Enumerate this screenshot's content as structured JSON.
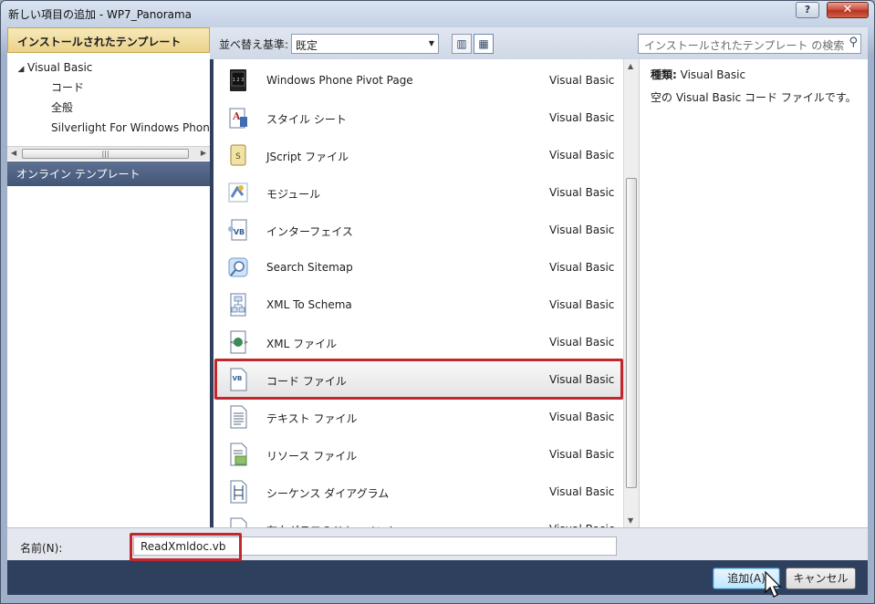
{
  "window": {
    "title": "新しい項目の追加 - WP7_Panorama",
    "help_glyph": "?",
    "close_glyph": "✕"
  },
  "left": {
    "header": "インストールされたテンプレート",
    "tree": [
      {
        "label": "Visual Basic",
        "expanded": true,
        "level": 0
      },
      {
        "label": "コード",
        "level": 1
      },
      {
        "label": "全般",
        "level": 1
      },
      {
        "label": "Silverlight For Windows Phone",
        "level": 1
      }
    ],
    "online": "オンライン テンプレート"
  },
  "toolbar": {
    "sort_label": "並べ替え基準:",
    "sort_value": "既定",
    "search_placeholder": "インストールされたテンプレート の検索"
  },
  "templates": [
    {
      "name": "Windows Phone Pivot Page",
      "lang": "Visual Basic",
      "icon": "pivot-page-icon"
    },
    {
      "name": "スタイル シート",
      "lang": "Visual Basic",
      "icon": "stylesheet-icon"
    },
    {
      "name": "JScript ファイル",
      "lang": "Visual Basic",
      "icon": "jscript-file-icon"
    },
    {
      "name": "モジュール",
      "lang": "Visual Basic",
      "icon": "module-icon"
    },
    {
      "name": "インターフェイス",
      "lang": "Visual Basic",
      "icon": "interface-icon"
    },
    {
      "name": "Search Sitemap",
      "lang": "Visual Basic",
      "icon": "search-sitemap-icon"
    },
    {
      "name": "XML To Schema",
      "lang": "Visual Basic",
      "icon": "xml-schema-icon"
    },
    {
      "name": "XML ファイル",
      "lang": "Visual Basic",
      "icon": "xml-file-icon"
    },
    {
      "name": "コード ファイル",
      "lang": "Visual Basic",
      "icon": "code-file-icon",
      "selected": true
    },
    {
      "name": "テキスト ファイル",
      "lang": "Visual Basic",
      "icon": "text-file-icon"
    },
    {
      "name": "リソース ファイル",
      "lang": "Visual Basic",
      "icon": "resource-file-icon"
    },
    {
      "name": "シーケンス ダイアグラム",
      "lang": "Visual Basic",
      "icon": "sequence-diagram-icon"
    },
    {
      "name": "有向グラフのドキュメント",
      "lang": "Visual Basic",
      "icon": "directed-graph-icon"
    }
  ],
  "details": {
    "kind_label": "種類:",
    "kind_value": "Visual Basic",
    "description": "空の Visual Basic コード ファイルです。"
  },
  "name_field": {
    "label": "名前(N):",
    "value": "ReadXmldoc.vb"
  },
  "buttons": {
    "add": "追加(A)",
    "cancel": "キャンセル"
  },
  "colors": {
    "highlight": "#c1272d",
    "online_bar": "#435677",
    "header_bar": "#ecd28a"
  }
}
